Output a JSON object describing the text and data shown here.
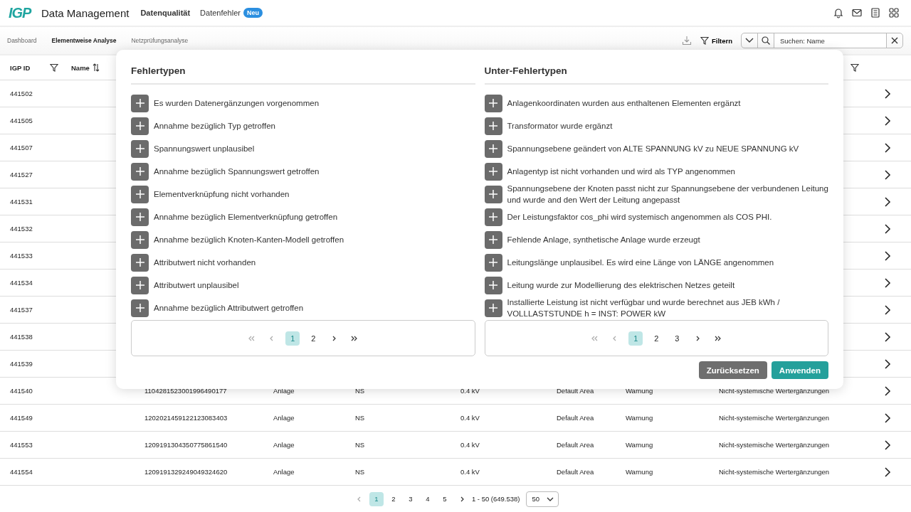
{
  "header": {
    "logo": "IGP",
    "app_title": "Data Management",
    "nav": [
      {
        "label": "Datenqualität",
        "selected": true
      },
      {
        "label": "Datenfehler",
        "selected": false,
        "badge": "Neu"
      }
    ]
  },
  "subnav": {
    "tabs": [
      {
        "label": "Dashboard",
        "selected": false
      },
      {
        "label": "Elementweise Analyse",
        "selected": true
      },
      {
        "label": "Netzprüfungsanalyse",
        "selected": false
      }
    ],
    "filter_button": "Filtern",
    "search": {
      "placeholder": "Suchen: Name"
    }
  },
  "table": {
    "columns": [
      {
        "label": "IGP ID",
        "kind": "filter"
      },
      {
        "label": "Name",
        "kind": "sort"
      }
    ],
    "rows": [
      {
        "igp_id": "441502"
      },
      {
        "igp_id": "441505"
      },
      {
        "igp_id": "441507"
      },
      {
        "igp_id": "441527"
      },
      {
        "igp_id": "441531"
      },
      {
        "igp_id": "441532"
      },
      {
        "igp_id": "441533"
      },
      {
        "igp_id": "441534"
      },
      {
        "igp_id": "441537"
      },
      {
        "igp_id": "441538"
      },
      {
        "igp_id": "441539"
      },
      {
        "igp_id": "441540",
        "cells": [
          "1104281523001996490177",
          "Anlage",
          "NS",
          "0.4 kV",
          "Default Area",
          "Warnung",
          "Nicht-systemische Wertergänzungen"
        ]
      },
      {
        "igp_id": "441549",
        "cells": [
          "1202021459122123083403",
          "Anlage",
          "NS",
          "0.4 kV",
          "Default Area",
          "Warnung",
          "Nicht-systemische Wertergänzungen"
        ]
      },
      {
        "igp_id": "441553",
        "cells": [
          "1209191304350775861540",
          "Anlage",
          "NS",
          "0.4 kV",
          "Default Area",
          "Warnung",
          "Nicht-systemische Wertergänzungen"
        ]
      },
      {
        "igp_id": "441554",
        "cells": [
          "1209191329249049324620",
          "Anlage",
          "NS",
          "0.4 kV",
          "Default Area",
          "Warnung",
          "Nicht-systemische Wertergänzungen"
        ]
      }
    ]
  },
  "modal": {
    "panels": [
      {
        "title": "Fehlertypen",
        "items": [
          "Es wurden Datenergänzungen vorgenommen",
          "Annahme bezüglich Typ getroffen",
          "Spannungswert unplausibel",
          "Annahme bezüglich Spannungswert getroffen",
          "Elementverknüpfung nicht vorhanden",
          "Annahme bezüglich Elementverknüpfung getroffen",
          "Annahme bezüglich Knoten-Kanten-Modell getroffen",
          "Attributwert nicht vorhanden",
          "Attributwert unplausibel",
          "Annahme bezüglich Attributwert getroffen"
        ],
        "pages": [
          {
            "label": "1",
            "selected": true
          },
          {
            "label": "2",
            "selected": false
          }
        ]
      },
      {
        "title": "Unter-Fehlertypen",
        "items": [
          "Anlagenkoordinaten wurden aus enthaltenen Elementen ergänzt",
          "Transformator wurde ergänzt",
          "Spannungsebene geändert von ALTE SPANNUNG kV zu NEUE SPANNUNG kV",
          "Anlagentyp ist nicht vorhanden und wird als TYP angenommen",
          "Spannungsebene der Knoten passt nicht zur Spannungsebene der verbundenen Leitung und wurde and den Wert der Leitung angepasst",
          "Der Leistungsfaktor cos_phi wird systemisch angenommen als COS PHI.",
          "Fehlende Anlage, synthetische Anlage wurde erzeugt",
          "Leitungslänge unplausibel. Es wird eine Länge von LÄNGE angenommen",
          "Leitung wurde zur Modellierung des elektrischen Netzes geteilt",
          "Installierte Leistung ist nicht verfügbar und wurde berechnet aus JEB kWh / VOLLLASTSTUNDE h = INST: POWER kW"
        ],
        "pages": [
          {
            "label": "1",
            "selected": true
          },
          {
            "label": "2",
            "selected": false
          },
          {
            "label": "3",
            "selected": false
          }
        ]
      }
    ],
    "reset_button": "Zurücksetzen",
    "apply_button": "Anwenden"
  },
  "pagination": {
    "pages": [
      {
        "label": "1",
        "selected": true
      },
      {
        "label": "2",
        "selected": false
      },
      {
        "label": "3",
        "selected": false
      },
      {
        "label": "4",
        "selected": false
      },
      {
        "label": "5",
        "selected": false
      }
    ],
    "range": "1 - 50 (649.538)",
    "page_size": "50"
  }
}
